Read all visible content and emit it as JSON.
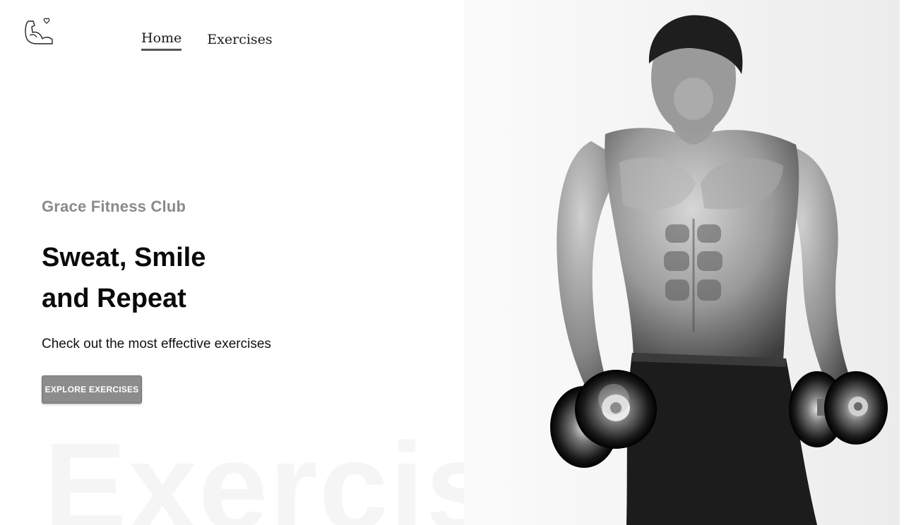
{
  "navbar": {
    "logo_icon": "flexed-bicep-with-heart-icon",
    "links": [
      {
        "label": "Home",
        "active": true
      },
      {
        "label": "Exercises",
        "active": false
      }
    ]
  },
  "hero": {
    "club_name": "Grace Fitness Club",
    "headline_line1": "Sweat, Smile",
    "headline_line2": "and Repeat",
    "subtext": "Check out the most effective exercises",
    "cta_label": "EXPLORE EXERCISES",
    "watermark": "Exercise",
    "image_icon": "muscular-man-with-dumbbells-photo"
  },
  "colors": {
    "club_name": "#8a8a8a",
    "headline": "#0a0a0a",
    "button_bg": "#8c8c8c",
    "button_text": "#ffffff",
    "nav_underline": "#555555",
    "watermark": "#f5f5f5"
  }
}
